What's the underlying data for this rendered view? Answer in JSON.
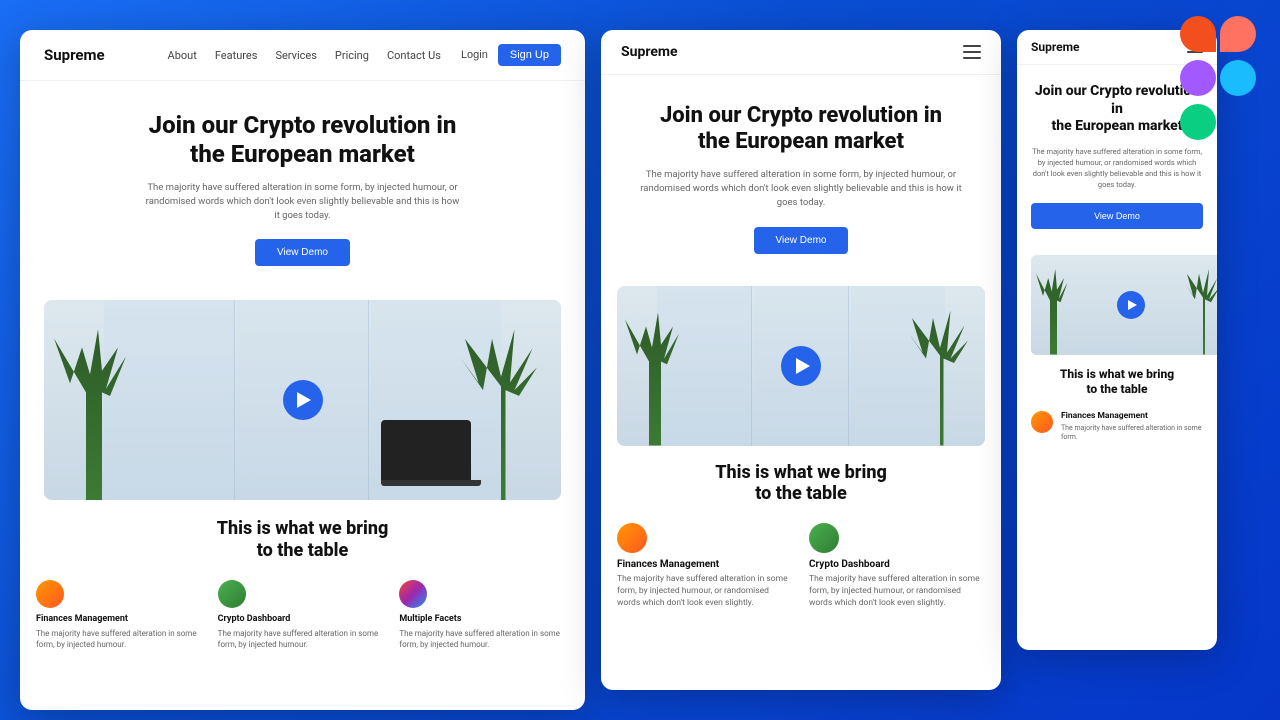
{
  "background": {
    "gradient_start": "#1a6ef5",
    "gradient_end": "#0536c8"
  },
  "figma_logo": {
    "alt": "Figma Logo"
  },
  "desktop": {
    "nav": {
      "logo": "Supreme",
      "links": [
        "About",
        "Features",
        "Services",
        "Pricing",
        "Contact Us"
      ],
      "login_label": "Login",
      "signup_label": "Sign Up"
    },
    "hero": {
      "title_line1": "Join our Crypto revolution in",
      "title_line2": "the European market",
      "subtitle": "The majority have suffered alteration in some form, by injected humour, or randomised words which don't look even slightly believable and this is how it goes today.",
      "cta_label": "View Demo"
    },
    "section2": {
      "title_line1": "This is what we bring",
      "title_line2": "to the table"
    },
    "features": [
      {
        "icon_type": "orange",
        "title": "Finances Management",
        "desc": "The majority have suffered alteration in some form, by injected humour."
      },
      {
        "icon_type": "green",
        "title": "Crypto Dashboard",
        "desc": "The majority have suffered alteration in some form, by injected humour."
      },
      {
        "icon_type": "multi",
        "title": "Multiple Facets",
        "desc": "The majority have suffered alteration in some form, by injected humour."
      }
    ]
  },
  "tablet": {
    "nav": {
      "logo": "Supreme"
    },
    "hero": {
      "title_line1": "Join our Crypto revolution in",
      "title_line2": "the European market",
      "subtitle": "The majority have suffered alteration in some form, by injected humour, or randomised words which don't look even slightly believable and this is how it goes today.",
      "cta_label": "View Demo"
    },
    "section2": {
      "title_line1": "This is what we bring",
      "title_line2": "to the table"
    },
    "features": [
      {
        "icon_type": "orange",
        "title": "Finances Management",
        "desc": "The majority have suffered alteration in some form, by injected humour, or randomised words which don't look even slightly."
      },
      {
        "icon_type": "green",
        "title": "Crypto Dashboard",
        "desc": "The majority have suffered alteration in some form, by injected humour, or randomised words which don't look even slightly."
      }
    ]
  },
  "mobile": {
    "nav": {
      "logo": "Supreme"
    },
    "hero": {
      "title_line1": "Join our Crypto revolution in",
      "title_line2": "the European market",
      "subtitle": "The majority have suffered alteration in some form, by injected humour, or randomised words which don't look even slightly believable and this is how it goes today.",
      "cta_label": "View Demo"
    },
    "section2": {
      "title_line1": "This is what we bring",
      "title_line2": "to the table"
    },
    "features": [
      {
        "icon_type": "orange",
        "title": "Finances Management",
        "desc": "The majority have suffered alteration in some form."
      }
    ]
  }
}
